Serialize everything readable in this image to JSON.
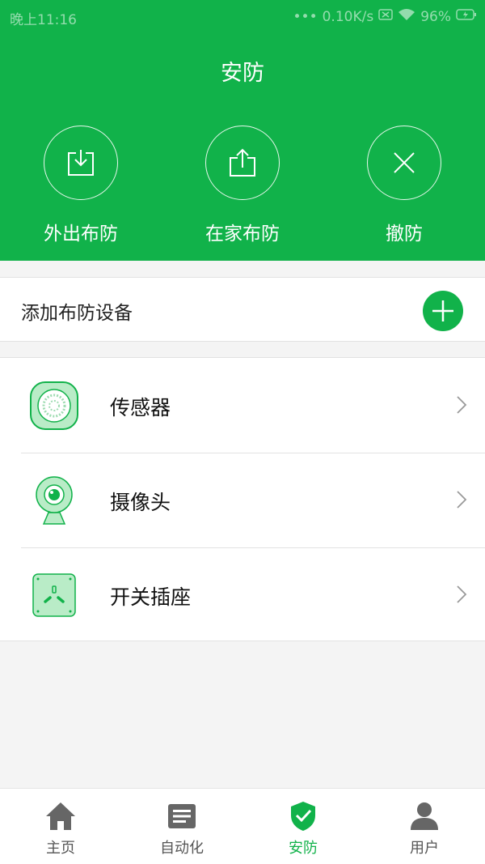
{
  "status_bar": {
    "time": "晚上11:16",
    "speed": "0.10K/s",
    "battery": "96%"
  },
  "header": {
    "title": "安防",
    "bg_color": "#11b24a"
  },
  "modes": [
    {
      "label": "外出布防",
      "icon": "download-icon"
    },
    {
      "label": "在家布防",
      "icon": "share-icon"
    },
    {
      "label": "撤防",
      "icon": "close-icon"
    }
  ],
  "add_device": {
    "label": "添加布防设备",
    "icon": "plus-icon"
  },
  "devices": [
    {
      "name": "传感器",
      "icon": "sensor-icon"
    },
    {
      "name": "摄像头",
      "icon": "camera-icon"
    },
    {
      "name": "开关插座",
      "icon": "socket-icon"
    }
  ],
  "tabs": [
    {
      "label": "主页",
      "icon": "home-icon",
      "active": false
    },
    {
      "label": "自动化",
      "icon": "list-icon",
      "active": false
    },
    {
      "label": "安防",
      "icon": "shield-check-icon",
      "active": true
    },
    {
      "label": "用户",
      "icon": "user-icon",
      "active": false
    }
  ],
  "colors": {
    "accent": "#11b24a",
    "icon_fill": "#b9ecc7",
    "inactive_icon": "#666666"
  }
}
